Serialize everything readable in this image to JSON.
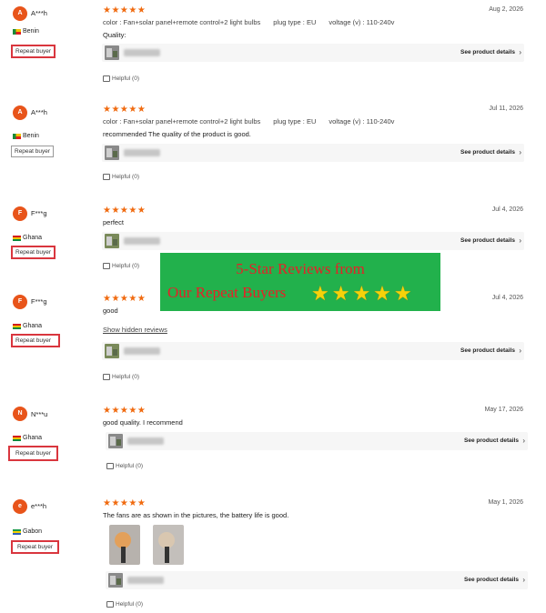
{
  "common": {
    "repeat_label": "Repeat buyer",
    "see_details": "See product details",
    "helpful": "Helpful (0)",
    "chevron": "›",
    "stars": "★★★★★"
  },
  "reviews": [
    {
      "avatar": "A",
      "user": "A***h",
      "country": "Benin",
      "flag": "benin",
      "date": "Aug 2, 2026",
      "specs": {
        "color_label": "color :",
        "color": "Fan+solar panel+remote control+2 light bulbs",
        "plug_label": "plug type :",
        "plug": "EU",
        "voltage_label": "voltage (v) :",
        "voltage": "110-240v"
      },
      "text": "Quality:"
    },
    {
      "avatar": "A",
      "user": "A***h",
      "country": "Benin",
      "flag": "benin",
      "date": "Jul 11, 2026",
      "specs": {
        "color_label": "color :",
        "color": "Fan+solar panel+remote control+2 light bulbs",
        "plug_label": "plug type :",
        "plug": "EU",
        "voltage_label": "voltage (v) :",
        "voltage": "110-240v"
      },
      "text": "recommended The quality of the product is good."
    },
    {
      "avatar": "F",
      "user": "F***g",
      "country": "Ghana",
      "flag": "ghana",
      "date": "Jul 4, 2026",
      "text": "perfect"
    },
    {
      "avatar": "F",
      "user": "F***g",
      "country": "Ghana",
      "flag": "ghana",
      "date": "Jul 4, 2026",
      "text": "good",
      "hidden_link": "Show hidden reviews"
    },
    {
      "avatar": "N",
      "user": "N***u",
      "country": "Ghana",
      "flag": "ghana",
      "date": "May 17, 2026",
      "text": "good quality. I recommend"
    },
    {
      "avatar": "e",
      "user": "e***h",
      "country": "Gabon",
      "flag": "gabon",
      "date": "May 1, 2026",
      "text": "The fans are as shown in the pictures, the battery life is good."
    }
  ],
  "banner": {
    "line1": "5-Star Reviews from",
    "line2": "Our Repeat Buyers",
    "stars": "★★★★★"
  },
  "colors": {
    "star": "#f06a0f",
    "avatar": "#e8541a",
    "repeat_border": "#d9363e",
    "banner_bg": "#22b14c",
    "banner_text": "#e81f27"
  }
}
